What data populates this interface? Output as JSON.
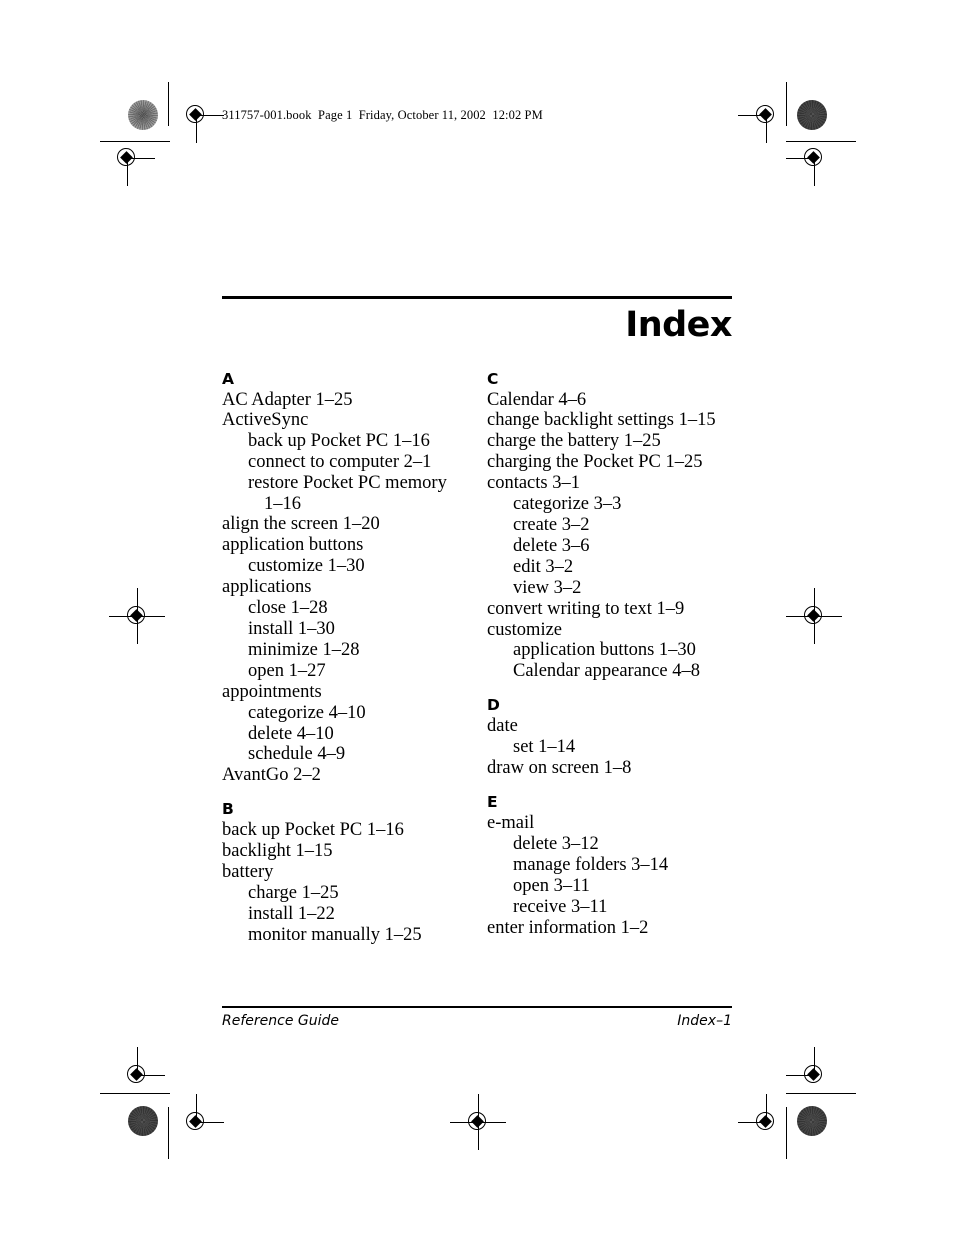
{
  "header": {
    "slug": "311757-001.book  Page 1  Friday, October 11, 2002  12:02 PM"
  },
  "title": "Index",
  "columns": {
    "left": [
      {
        "letter": "A",
        "entries": [
          {
            "text": "AC Adapter 1–25",
            "level": 0,
            "wrapped": false
          },
          {
            "text": "ActiveSync",
            "level": 0,
            "wrapped": false
          },
          {
            "text": "back up Pocket PC 1–16",
            "level": 1,
            "wrapped": false
          },
          {
            "text": "connect to computer 2–1",
            "level": 1,
            "wrapped": false
          },
          {
            "text": "restore Pocket PC memory 1–16",
            "level": 1,
            "wrapped": true
          },
          {
            "text": "align the screen 1–20",
            "level": 0,
            "wrapped": false
          },
          {
            "text": "application buttons",
            "level": 0,
            "wrapped": false
          },
          {
            "text": "customize 1–30",
            "level": 1,
            "wrapped": false
          },
          {
            "text": "applications",
            "level": 0,
            "wrapped": false
          },
          {
            "text": "close 1–28",
            "level": 1,
            "wrapped": false
          },
          {
            "text": "install 1–30",
            "level": 1,
            "wrapped": false
          },
          {
            "text": "minimize 1–28",
            "level": 1,
            "wrapped": false
          },
          {
            "text": "open 1–27",
            "level": 1,
            "wrapped": false
          },
          {
            "text": "appointments",
            "level": 0,
            "wrapped": false
          },
          {
            "text": "categorize 4–10",
            "level": 1,
            "wrapped": false
          },
          {
            "text": "delete 4–10",
            "level": 1,
            "wrapped": false
          },
          {
            "text": "schedule 4–9",
            "level": 1,
            "wrapped": false
          },
          {
            "text": "AvantGo 2–2",
            "level": 0,
            "wrapped": false
          }
        ]
      },
      {
        "letter": "B",
        "entries": [
          {
            "text": "back up Pocket PC 1–16",
            "level": 0,
            "wrapped": false
          },
          {
            "text": "backlight 1–15",
            "level": 0,
            "wrapped": false
          },
          {
            "text": "battery",
            "level": 0,
            "wrapped": false
          },
          {
            "text": "charge 1–25",
            "level": 1,
            "wrapped": false
          },
          {
            "text": "install 1–22",
            "level": 1,
            "wrapped": false
          },
          {
            "text": "monitor manually 1–25",
            "level": 1,
            "wrapped": false
          }
        ]
      }
    ],
    "right": [
      {
        "letter": "C",
        "entries": [
          {
            "text": "Calendar 4–6",
            "level": 0,
            "wrapped": false
          },
          {
            "text": "change backlight settings 1–15",
            "level": 0,
            "wrapped": false
          },
          {
            "text": "charge the battery 1–25",
            "level": 0,
            "wrapped": false
          },
          {
            "text": "charging the Pocket PC 1–25",
            "level": 0,
            "wrapped": false
          },
          {
            "text": "contacts 3–1",
            "level": 0,
            "wrapped": false
          },
          {
            "text": "categorize 3–3",
            "level": 1,
            "wrapped": false
          },
          {
            "text": "create 3–2",
            "level": 1,
            "wrapped": false
          },
          {
            "text": "delete 3–6",
            "level": 1,
            "wrapped": false
          },
          {
            "text": "edit 3–2",
            "level": 1,
            "wrapped": false
          },
          {
            "text": "view 3–2",
            "level": 1,
            "wrapped": false
          },
          {
            "text": "convert writing to text 1–9",
            "level": 0,
            "wrapped": false
          },
          {
            "text": "customize",
            "level": 0,
            "wrapped": false
          },
          {
            "text": "application buttons 1–30",
            "level": 1,
            "wrapped": false
          },
          {
            "text": "Calendar appearance 4–8",
            "level": 1,
            "wrapped": false
          }
        ]
      },
      {
        "letter": "D",
        "entries": [
          {
            "text": "date",
            "level": 0,
            "wrapped": false
          },
          {
            "text": "set 1–14",
            "level": 1,
            "wrapped": false
          },
          {
            "text": "draw on screen 1–8",
            "level": 0,
            "wrapped": false
          }
        ]
      },
      {
        "letter": "E",
        "entries": [
          {
            "text": "e-mail",
            "level": 0,
            "wrapped": false
          },
          {
            "text": "delete 3–12",
            "level": 1,
            "wrapped": false
          },
          {
            "text": "manage folders 3–14",
            "level": 1,
            "wrapped": false
          },
          {
            "text": "open 3–11",
            "level": 1,
            "wrapped": false
          },
          {
            "text": "receive 3–11",
            "level": 1,
            "wrapped": false
          },
          {
            "text": "enter information 1–2",
            "level": 0,
            "wrapped": false
          }
        ]
      }
    ]
  },
  "footer": {
    "left": "Reference Guide",
    "right": "Index–1"
  }
}
